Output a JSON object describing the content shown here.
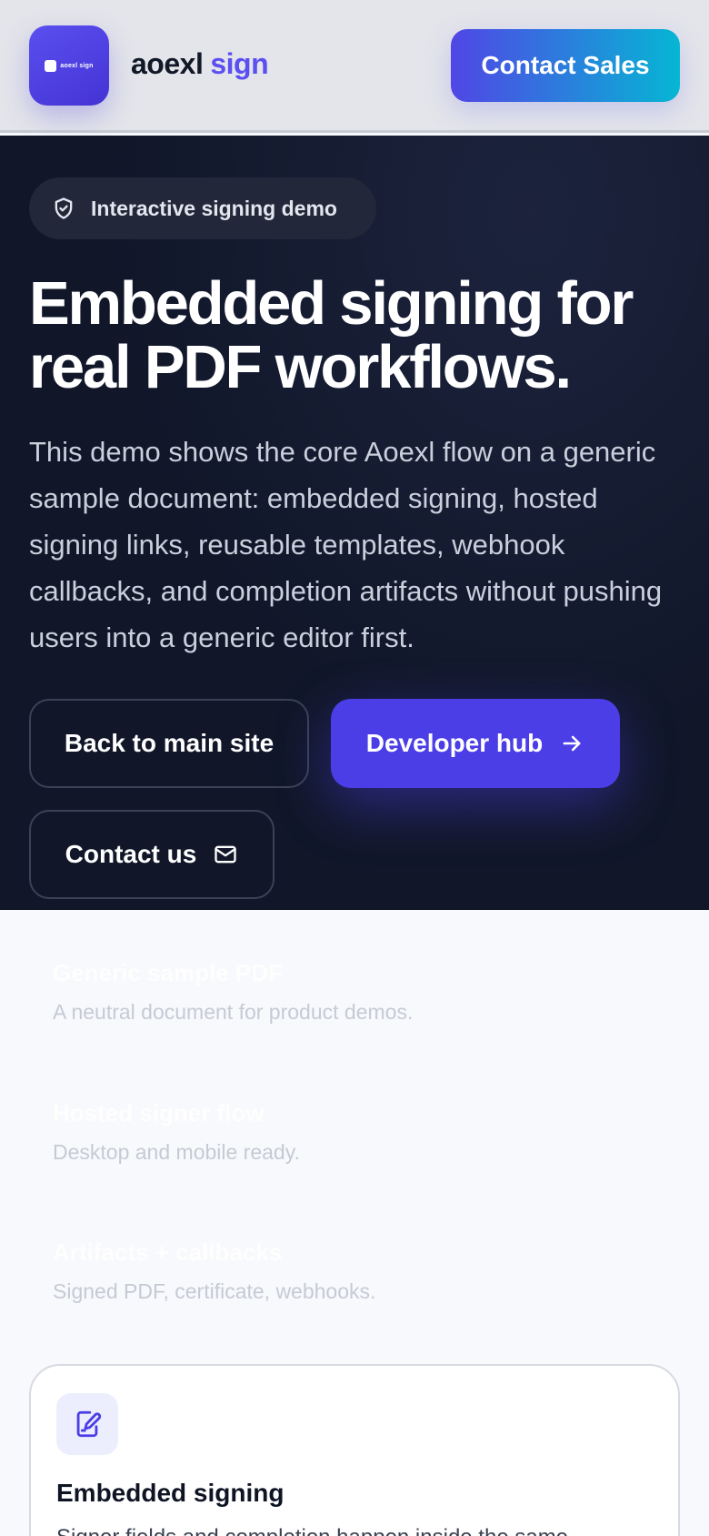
{
  "header": {
    "logo_text": "aoexl sign",
    "brand_name": "aoexl",
    "brand_suffix": "sign",
    "contact_sales": "Contact Sales"
  },
  "hero": {
    "badge": "Interactive signing demo",
    "title": "Embedded signing for real PDF workflows.",
    "description": "This demo shows the core Aoexl flow on a generic sample document: embedded signing, hosted signing links, reusable templates, webhook callbacks, and completion artifacts without pushing users into a generic editor first.",
    "buttons": {
      "back": "Back to main site",
      "developer": "Developer hub",
      "contact": "Contact us"
    }
  },
  "features": [
    {
      "title": "Generic sample PDF",
      "desc": "A neutral document for product demos."
    },
    {
      "title": "Hosted signer flow",
      "desc": "Desktop and mobile ready."
    },
    {
      "title": "Artifacts + callbacks",
      "desc": "Signed PDF, certificate, webhooks."
    }
  ],
  "card": {
    "title": "Embedded signing",
    "desc": "Signer fields and completion happen inside the same"
  },
  "colors": {
    "accent": "#4b3ee6",
    "hero_bg": "#111729",
    "cyan": "#06b6d4"
  },
  "icons": {
    "badge": "shield-check-icon",
    "developer": "arrow-right-icon",
    "contact": "mail-icon",
    "card": "file-signature-icon"
  }
}
